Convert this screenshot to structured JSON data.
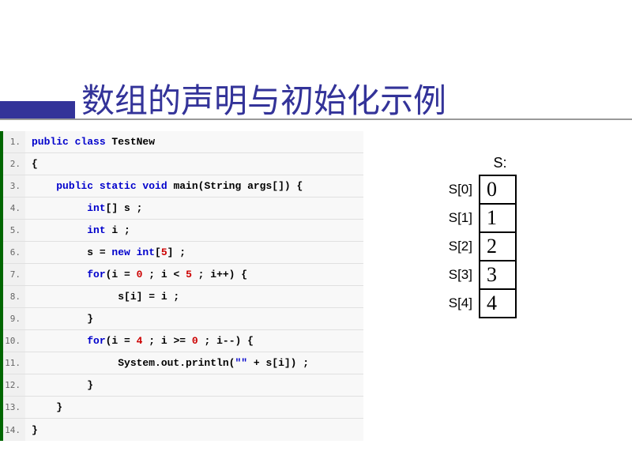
{
  "title": "数组的声明与初始化示例",
  "code": {
    "lines": [
      {
        "num": "1.",
        "tokens": [
          {
            "cls": "kw",
            "t": "public class"
          },
          {
            "cls": "txt",
            "t": " TestNew"
          }
        ]
      },
      {
        "num": "2.",
        "tokens": [
          {
            "cls": "txt",
            "t": "{"
          }
        ]
      },
      {
        "num": "3.",
        "tokens": [
          {
            "cls": "txt",
            "t": "    "
          },
          {
            "cls": "kw",
            "t": "public static void"
          },
          {
            "cls": "txt",
            "t": " main(String args[]) {"
          }
        ]
      },
      {
        "num": "4.",
        "tokens": [
          {
            "cls": "txt",
            "t": "         "
          },
          {
            "cls": "kw",
            "t": "int"
          },
          {
            "cls": "txt",
            "t": "[] s ;"
          }
        ]
      },
      {
        "num": "5.",
        "tokens": [
          {
            "cls": "txt",
            "t": "         "
          },
          {
            "cls": "kw",
            "t": "int"
          },
          {
            "cls": "txt",
            "t": " i ;"
          }
        ]
      },
      {
        "num": "6.",
        "tokens": [
          {
            "cls": "txt",
            "t": "         s = "
          },
          {
            "cls": "kw",
            "t": "new int"
          },
          {
            "cls": "txt",
            "t": "["
          },
          {
            "cls": "num",
            "t": "5"
          },
          {
            "cls": "txt",
            "t": "] ;"
          }
        ]
      },
      {
        "num": "7.",
        "tokens": [
          {
            "cls": "txt",
            "t": "         "
          },
          {
            "cls": "kw",
            "t": "for"
          },
          {
            "cls": "txt",
            "t": "(i = "
          },
          {
            "cls": "num",
            "t": "0"
          },
          {
            "cls": "txt",
            "t": " ; i < "
          },
          {
            "cls": "num",
            "t": "5"
          },
          {
            "cls": "txt",
            "t": " ; i++) {"
          }
        ]
      },
      {
        "num": "8.",
        "tokens": [
          {
            "cls": "txt",
            "t": "              s[i] = i ;"
          }
        ]
      },
      {
        "num": "9.",
        "tokens": [
          {
            "cls": "txt",
            "t": "         }"
          }
        ]
      },
      {
        "num": "10.",
        "tokens": [
          {
            "cls": "txt",
            "t": "         "
          },
          {
            "cls": "kw",
            "t": "for"
          },
          {
            "cls": "txt",
            "t": "(i = "
          },
          {
            "cls": "num",
            "t": "4"
          },
          {
            "cls": "txt",
            "t": " ; i >= "
          },
          {
            "cls": "num",
            "t": "0"
          },
          {
            "cls": "txt",
            "t": " ; i--) {"
          }
        ]
      },
      {
        "num": "11.",
        "tokens": [
          {
            "cls": "txt",
            "t": "              System.out.println("
          },
          {
            "cls": "str",
            "t": "\"\""
          },
          {
            "cls": "txt",
            "t": " + s[i]) ;"
          }
        ]
      },
      {
        "num": "12.",
        "tokens": [
          {
            "cls": "txt",
            "t": "         }"
          }
        ]
      },
      {
        "num": "13.",
        "tokens": [
          {
            "cls": "txt",
            "t": "    }"
          }
        ]
      },
      {
        "num": "14.",
        "tokens": [
          {
            "cls": "txt",
            "t": "}"
          }
        ]
      }
    ]
  },
  "array": {
    "header": "S:",
    "rows": [
      {
        "label": "S[0]",
        "value": "0"
      },
      {
        "label": "S[1]",
        "value": "1"
      },
      {
        "label": "S[2]",
        "value": "2"
      },
      {
        "label": "S[3]",
        "value": "3"
      },
      {
        "label": "S[4]",
        "value": "4"
      }
    ]
  }
}
